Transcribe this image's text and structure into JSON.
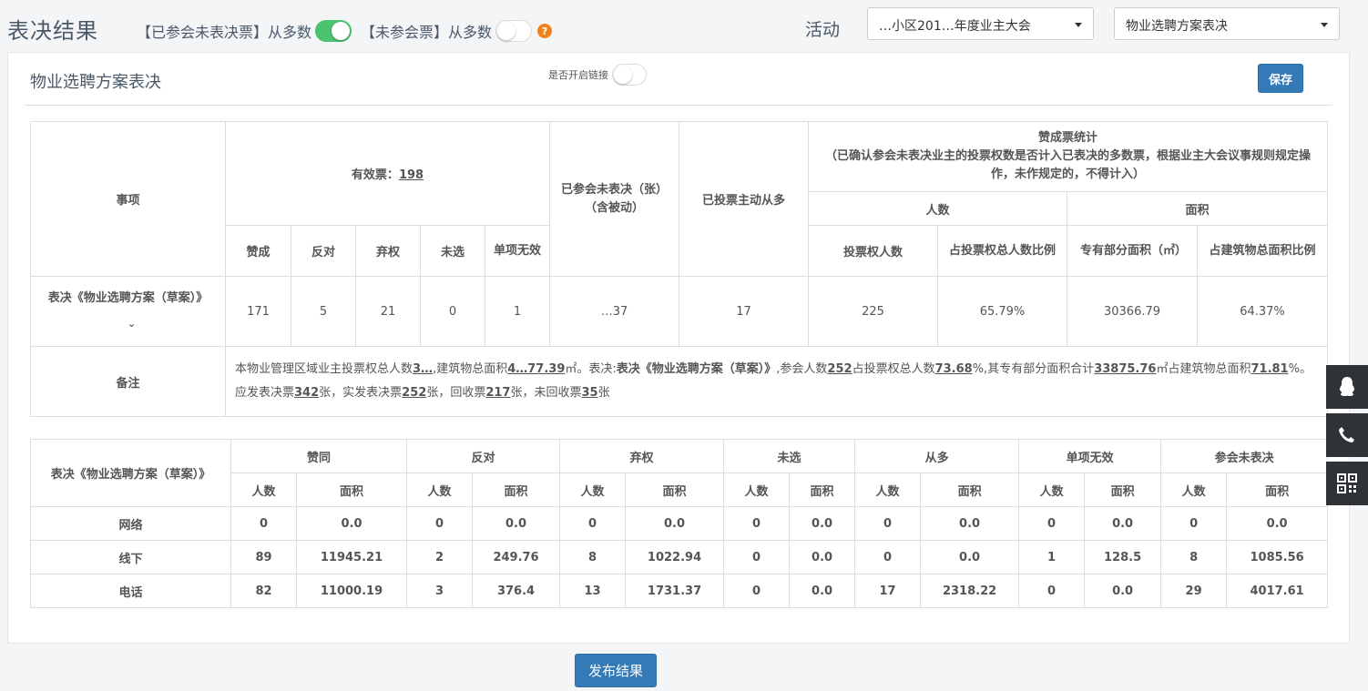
{
  "header": {
    "title": "表决结果",
    "toggle1_label": "【已参会未表决票】从多数",
    "toggle2_label": "【未参会票】从多数",
    "help_glyph": "?",
    "activity_label": "活动",
    "activity_value": "…小区201…年度业主大会",
    "vote_value": "物业选聘方案表决"
  },
  "panel": {
    "title": "物业选聘方案表决",
    "link_label": "是否开启链接",
    "save_label": "保存"
  },
  "summary": {
    "col_item": "事项",
    "valid_label": "有效票：",
    "valid_count": "198",
    "col_attended_not_voted": "已参会未表决（张）（含被动）",
    "col_voted_follow": "已投票主动从多",
    "col_approve_stats": "赞成票统计",
    "approve_stats_note": "（已确认参会未表决业主的投票权数是否计入已表决的多数票，根据业主大会议事规则规定操作，未作规定的，不得计入）",
    "col_people": "人数",
    "col_area": "面积",
    "sub_approve": "赞成",
    "sub_oppose": "反对",
    "sub_abstain": "弃权",
    "sub_unselected": "未选",
    "sub_invalid": "单项无效",
    "sub_voters": "投票权人数",
    "sub_voters_ratio": "占投票权总人数比例",
    "sub_exclusive_area": "专有部分面积（㎡）",
    "sub_area_ratio": "占建筑物总面积比例",
    "row_item": "表决《物业选聘方案（草案）》",
    "row_chevron": "⌄",
    "row_values": {
      "approve": "171",
      "oppose": "5",
      "abstain": "21",
      "unselected": "0",
      "invalid": "1",
      "attended_not_voted": "…37",
      "voted_follow": "17",
      "voters": "225",
      "voters_ratio": "65.79%",
      "exclusive_area": "30366.79",
      "area_ratio": "64.37%"
    },
    "remark_label": "备注",
    "remark": {
      "p1": "本物业管理区域业主投票权总人数",
      "v1": "3…",
      "p2": ",建筑物总面积",
      "v2": "4…77.39",
      "p3": "㎡。表决:",
      "v3": "表决《物业选聘方案（草案）》",
      "p4": ",参会人数",
      "v4": "252",
      "p5": "占投票权总人数",
      "v5": "73.68",
      "p6": "%,其专有部分面积合计",
      "v6": "33875.76",
      "p7": "㎡占建筑物总面积",
      "v7": "71.81",
      "p8": "%。应发表决票",
      "v8": "342",
      "p9": "张，实发表决票",
      "v9": "252",
      "p10": "张，回收票",
      "v10": "217",
      "p11": "张，未回收票",
      "v11": "35",
      "p12": "张"
    }
  },
  "detail": {
    "row_header": "表决《物业选聘方案（草案）》",
    "groups": [
      "赞同",
      "反对",
      "弃权",
      "未选",
      "从多",
      "单项无效",
      "参会未表决"
    ],
    "sub_people": "人数",
    "sub_area": "面积",
    "rows": [
      {
        "label": "网络",
        "cells": [
          "0",
          "0.0",
          "0",
          "0.0",
          "0",
          "0.0",
          "0",
          "0.0",
          "0",
          "0.0",
          "0",
          "0.0",
          "0",
          "0.0"
        ]
      },
      {
        "label": "线下",
        "cells": [
          "89",
          "11945.21",
          "2",
          "249.76",
          "8",
          "1022.94",
          "0",
          "0.0",
          "0",
          "0.0",
          "1",
          "128.5",
          "8",
          "1085.56"
        ]
      },
      {
        "label": "电话",
        "cells": [
          "82",
          "11000.19",
          "3",
          "376.4",
          "13",
          "1731.37",
          "0",
          "0.0",
          "17",
          "2318.22",
          "0",
          "0.0",
          "29",
          "4017.61"
        ]
      }
    ]
  },
  "publish_label": "发布结果",
  "side_tools": {
    "icons": [
      "qq-icon",
      "phone-icon",
      "qrcode-icon"
    ]
  },
  "colors": {
    "primary": "#337ab7",
    "toggle_on": "#4cc36e",
    "help": "#f0821e",
    "sidebar": "#2f3338"
  }
}
